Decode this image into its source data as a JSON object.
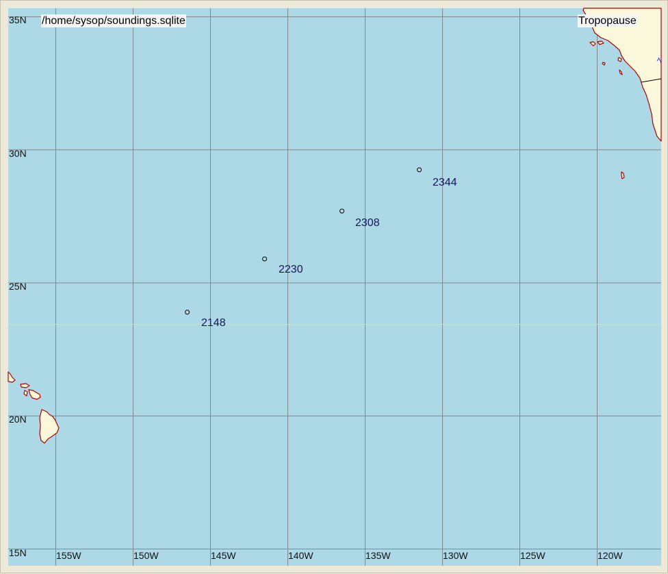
{
  "map": {
    "file_label": "/home/sysop/soundings.sqlite",
    "layer_label": "Tropopause",
    "colors": {
      "ocean": "#add8e6",
      "land": "#fbf8dc",
      "coast": "#b30000",
      "grid": "#7d8a90",
      "tropic": "#e6f03c",
      "border": "#000000",
      "lake": "#1a3cff",
      "station_text": "#15155a",
      "background": "#ece9d8"
    },
    "latitudes": [
      {
        "value": 35,
        "label": "35N"
      },
      {
        "value": 30,
        "label": "30N"
      },
      {
        "value": 25,
        "label": "25N"
      },
      {
        "value": 20,
        "label": "20N"
      },
      {
        "value": 15,
        "label": "15N"
      }
    ],
    "longitudes": [
      {
        "value": -155,
        "label": "155W"
      },
      {
        "value": -150,
        "label": "150W"
      },
      {
        "value": -145,
        "label": "145W"
      },
      {
        "value": -140,
        "label": "140W"
      },
      {
        "value": -135,
        "label": "135W"
      },
      {
        "value": -130,
        "label": "130W"
      },
      {
        "value": -125,
        "label": "125W"
      },
      {
        "value": -120,
        "label": "120W"
      }
    ],
    "tropic_latitude": 23.44,
    "stations": [
      {
        "label": "2148",
        "lat": 23.9,
        "lon": -146.5
      },
      {
        "label": "2230",
        "lat": 25.9,
        "lon": -141.5
      },
      {
        "label": "2308",
        "lat": 27.7,
        "lon": -136.5
      },
      {
        "label": "2344",
        "lat": 29.25,
        "lon": -131.5
      }
    ]
  }
}
